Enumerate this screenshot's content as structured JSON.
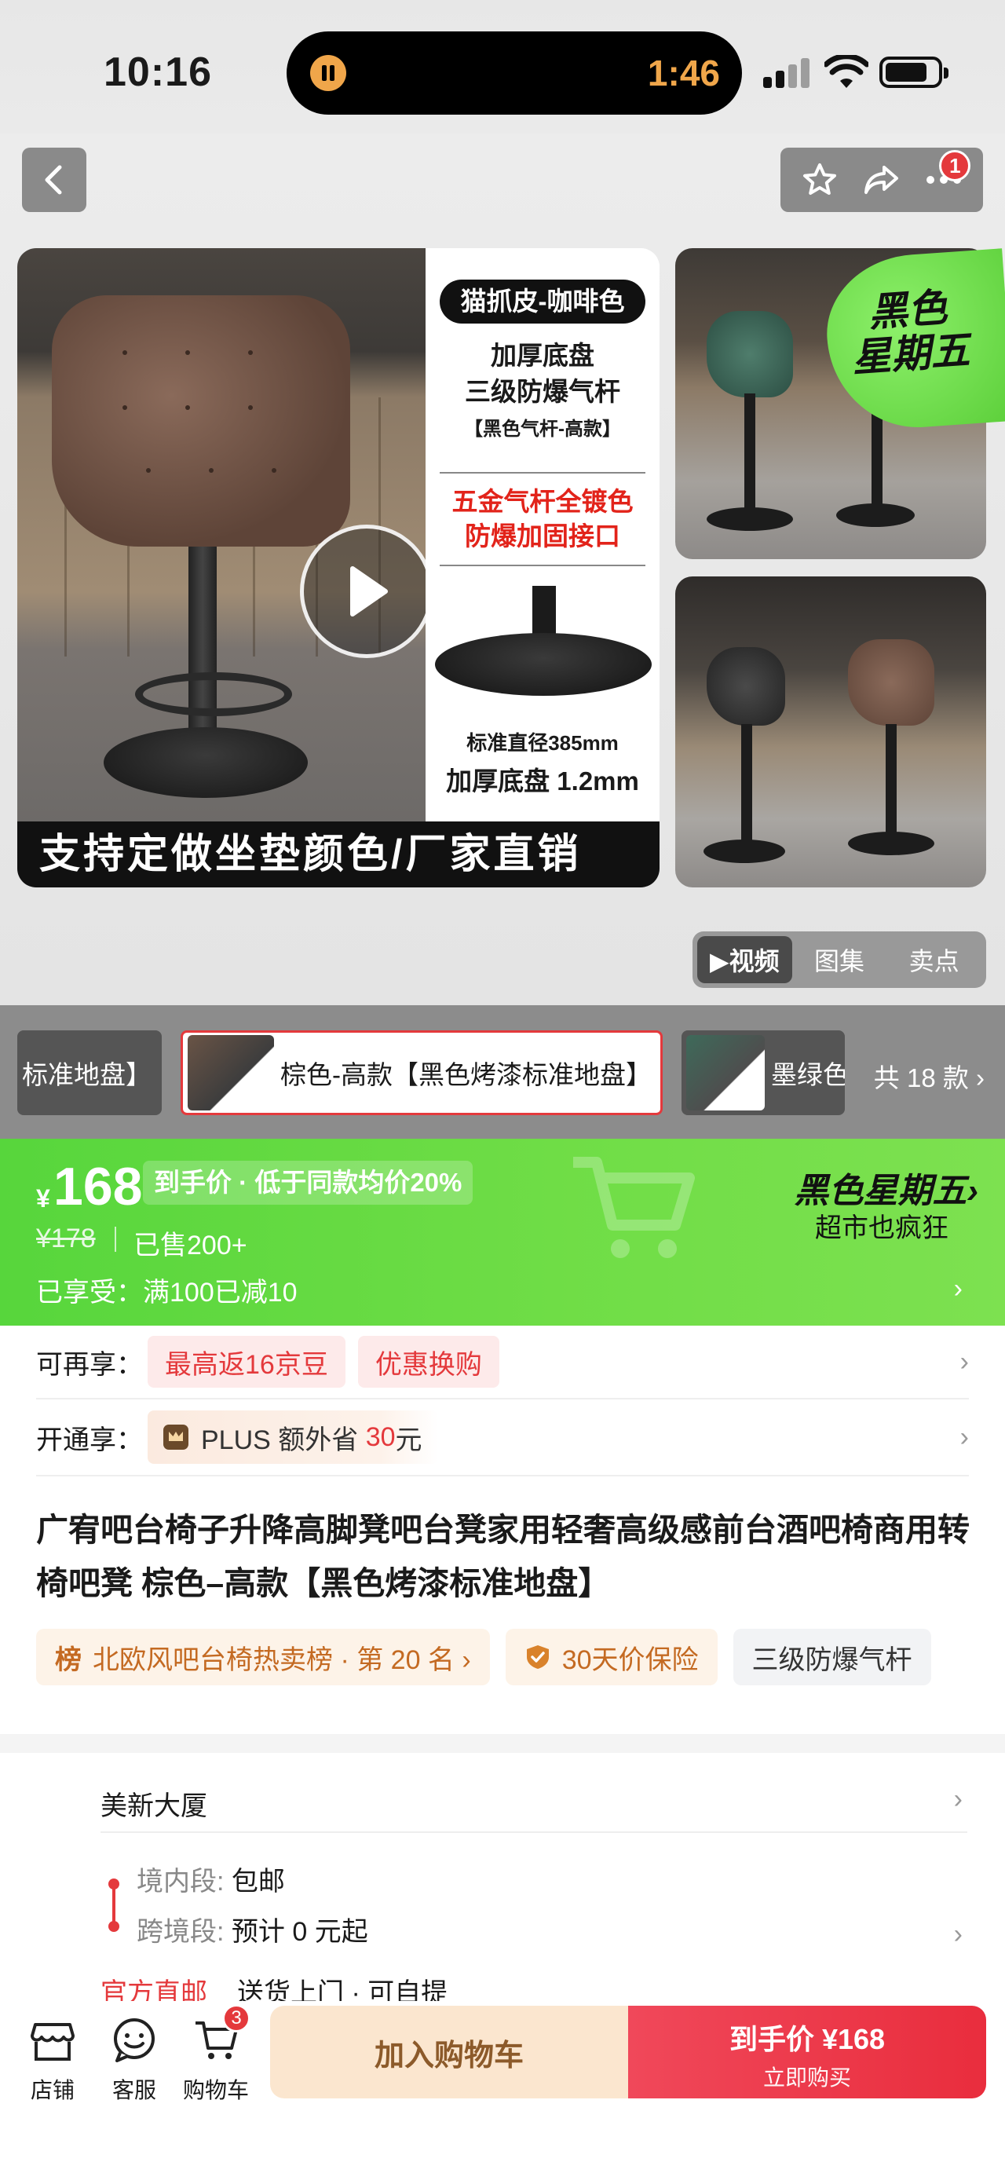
{
  "status_bar": {
    "time": "10:16",
    "island_timer": "1:46"
  },
  "header": {
    "cart_badge": "1",
    "icons": [
      "back-icon",
      "star-icon",
      "share-icon",
      "more-icon"
    ]
  },
  "gallery": {
    "spec_badge": "猫抓皮-咖啡色",
    "spec_line1": "加厚底盘",
    "spec_line2": "三级防爆气杆",
    "spec_small": "【黑色气杆-高款】",
    "spec_red1": "五金气杆全镀色",
    "spec_red2": "防爆加固接口",
    "spec_diameter": "标准直径385mm",
    "spec_thickness": "加厚底盘 1.2mm",
    "caption": "支持定做坐垫颜色/厂家直销",
    "promo_sticker_l1": "黑色",
    "promo_sticker_l2": "星期五",
    "tabs": [
      "▶视频",
      "图集",
      "卖点"
    ]
  },
  "variants": {
    "items": [
      "标准地盘】",
      "棕色-高款【黑色烤漆标准地盘】",
      "墨绿色"
    ],
    "count": "共 18 款 ›"
  },
  "price": {
    "currency": "¥",
    "amount": "168",
    "tag": "到手价 · 低于同款均价20%",
    "original": "¥178",
    "sold": "已售200+",
    "enjoyed": "已享受：满100已减10",
    "campaign_title": "黑色星期五›",
    "campaign_sub": "超市也疯狂",
    "banner_color": "#5fd840"
  },
  "benefits": {
    "row1_label": "可再享：",
    "row1_chip1": "最高返16京豆",
    "row1_chip2": "优惠换购",
    "row2_label": "开通享：",
    "plus_text_a": "PLUS 额外省 ",
    "plus_amount": "30",
    "plus_text_b": "元"
  },
  "product": {
    "title": "广宥吧台椅子升降高脚凳吧台凳家用轻奢高级感前台酒吧椅商用转椅吧凳 棕色–高款【黑色烤漆标准地盘】",
    "tag_rank_prefix": "榜",
    "tag_rank": "北欧风吧台椅热卖榜 · 第 20 名 ›",
    "tag_guard": "30天价保险",
    "tag_feature": "三级防爆气杆"
  },
  "delivery": {
    "address": "美新大厦",
    "domestic_key": "境内段:",
    "domestic_val": "包邮",
    "cross_key": "跨境段:",
    "cross_val": "预计 0 元起",
    "official": "官方直邮",
    "service": "送货上门 · 可自提"
  },
  "bottom_bar": {
    "store": "店铺",
    "service": "客服",
    "cart": "购物车",
    "cart_badge": "3",
    "add_to_cart": "加入购物车",
    "buy_price": "到手价 ¥168",
    "buy_now": "立即购买",
    "accent": "#e92d3d"
  }
}
